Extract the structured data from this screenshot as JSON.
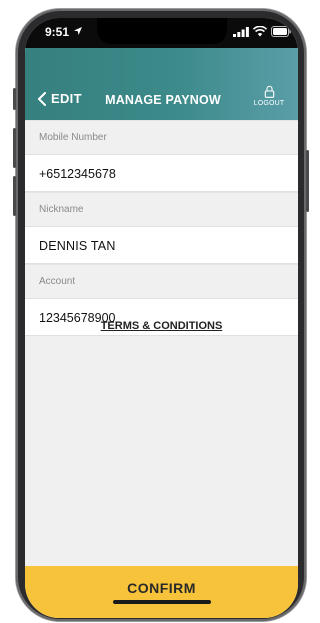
{
  "status_bar": {
    "time": "9:51"
  },
  "header": {
    "back_label": "EDIT",
    "title": "MANAGE PAYNOW",
    "logout_label": "LOGOUT"
  },
  "form": {
    "mobile_label": "Mobile Number",
    "mobile_value": "+6512345678",
    "nickname_label": "Nickname",
    "nickname_value": "DENNIS TAN",
    "account_label": "Account",
    "account_value": "12345678900"
  },
  "terms_link": "TERMS & CONDITIONS",
  "confirm_label": "CONFIRM",
  "colors": {
    "header": "#3c8a8a",
    "confirm": "#f7c33a",
    "background": "#f0f0f0"
  },
  "icons": [
    "location-arrow-icon",
    "signal-icon",
    "wifi-icon",
    "battery-icon",
    "chevron-left-icon",
    "lock-icon"
  ]
}
